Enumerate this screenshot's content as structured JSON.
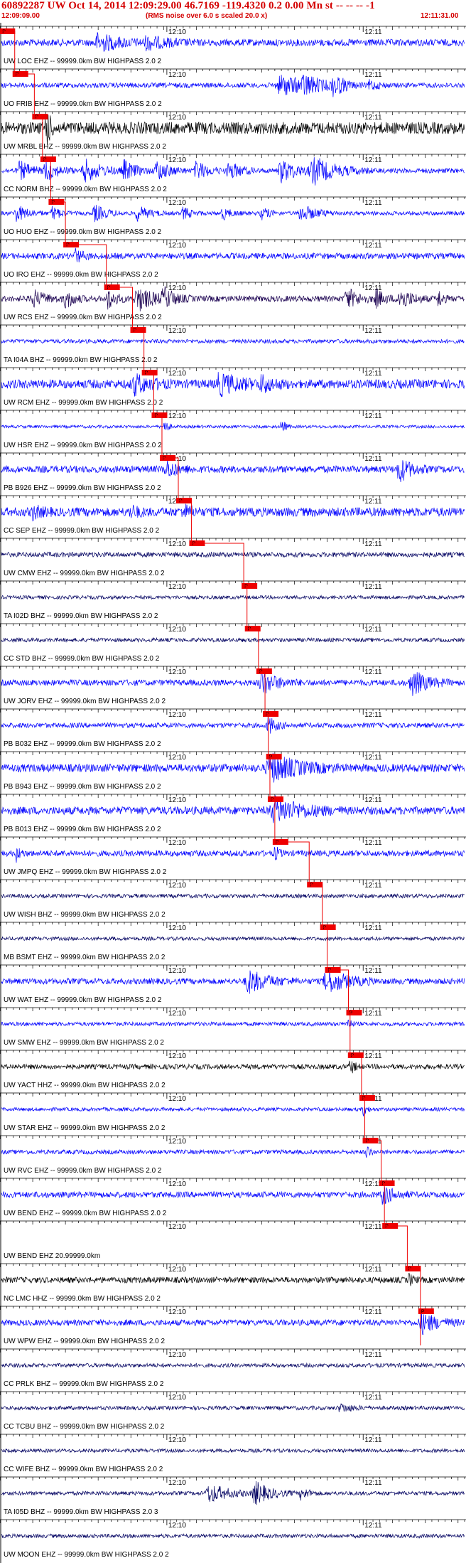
{
  "header": {
    "title": "60892287 UW Oct 14, 2014 12:09:29.00   46.7169 -119.4320  0.2 0.00 Mn st -- -- --  -1",
    "start_time": "12:09:09.00",
    "scale_note": "(RMS noise over 6.0 s scaled 20.0 x)",
    "end_time": "12:11:31.00"
  },
  "chart_data": {
    "type": "line",
    "title": "60892287 UW Oct 14, 2014 12:09:29.00   46.7169 -119.4320  0.2 0.00 Mn st -- -- --  -1",
    "x_axis": {
      "unit": "seconds after 12:09:09.00",
      "range": [
        0,
        142
      ],
      "tick_labels": [
        "12:10",
        "12:11"
      ],
      "tick_label_offsets_s": [
        51,
        111
      ]
    },
    "pick_label": "P",
    "traces": [
      {
        "label": "UW LOC EHZ -- 99999.0km BW  HIGHPASS  2.0  2",
        "color": "#0000ff",
        "pick_s": 0.5,
        "amplitude": 0.35,
        "bursts": [
          [
            30,
            5,
            0.9
          ],
          [
            45,
            5,
            0.6
          ]
        ]
      },
      {
        "label": "UO FRIB EHZ -- 99999.0km BW  HIGHPASS  2.0  2",
        "color": "#0000ff",
        "pick_s": 4.5,
        "amplitude": 0.25,
        "bursts": [
          [
            86,
            7,
            1.0
          ],
          [
            93,
            4,
            0.7
          ],
          [
            102,
            3,
            0.9
          ],
          [
            113,
            2,
            0.5
          ]
        ]
      },
      {
        "label": "UW MRBL BHZ -- 99999.0km BW  HIGHPASS  2.0  2",
        "color": "#000000",
        "pick_s": 10.5,
        "amplitude": 0.6,
        "bursts": [
          [
            14,
            1,
            2.2
          ]
        ]
      },
      {
        "label": "CC NORM BHZ -- 99999.0km BW  HIGHPASS  2.0  2",
        "color": "#0000ff",
        "pick_s": 13.0,
        "amplitude": 0.25,
        "bursts": [
          [
            6,
            3,
            0.9
          ],
          [
            14,
            3,
            1.0
          ],
          [
            26,
            4,
            1.1
          ],
          [
            38,
            3,
            1.0
          ],
          [
            48,
            3,
            1.0
          ],
          [
            60,
            3,
            0.9
          ],
          [
            70,
            3,
            0.9
          ],
          [
            86,
            4,
            1.1
          ],
          [
            96,
            6,
            1.2
          ]
        ]
      },
      {
        "label": "UO HUO EHZ -- 99999.0km BW  HIGHPASS  2.0  2",
        "color": "#0000ff",
        "pick_s": 15.5,
        "amplitude": 0.2,
        "bursts": [
          [
            5,
            3,
            0.8
          ],
          [
            16,
            2,
            0.7
          ],
          [
            29,
            3,
            0.8
          ],
          [
            42,
            3,
            0.7
          ],
          [
            56,
            2,
            0.6
          ],
          [
            68,
            2,
            0.6
          ],
          [
            80,
            2,
            0.6
          ],
          [
            92,
            4,
            0.8
          ]
        ]
      },
      {
        "label": "UO IRO EHZ -- 99999.0km BW  HIGHPASS  2.0  2",
        "color": "#0000ff",
        "pick_s": 20.0,
        "amplitude": 0.3,
        "bursts": [
          [
            23,
            2,
            0.6
          ]
        ]
      },
      {
        "label": "UW RCS EHZ -- 99999.0km BW  HIGHPASS  2.0  2",
        "color": "#1a0050",
        "pick_s": 32.5,
        "amplitude": 0.3,
        "bursts": [
          [
            10,
            3,
            0.8
          ],
          [
            20,
            2,
            1.0
          ],
          [
            33,
            2,
            1.0
          ],
          [
            42,
            4,
            1.2
          ],
          [
            50,
            3,
            0.9
          ],
          [
            106,
            3,
            1.0
          ],
          [
            115,
            2,
            0.9
          ],
          [
            122,
            3,
            1.1
          ],
          [
            134,
            1,
            1.0
          ]
        ]
      },
      {
        "label": "TA I04A BHZ -- 99999.0km BW  HIGHPASS  2.0  2",
        "color": "#0000ff",
        "pick_s": 40.5,
        "amplitude": 0.2,
        "bursts": []
      },
      {
        "label": "UW RCM EHZ -- 99999.0km BW  HIGHPASS  2.0  2",
        "color": "#0000ff",
        "pick_s": 44.0,
        "amplitude": 0.45,
        "bursts": [
          [
            41,
            4,
            0.9
          ],
          [
            67,
            5,
            1.0
          ],
          [
            80,
            3,
            0.7
          ]
        ]
      },
      {
        "label": "UW HSR EHZ -- 99999.0km BW  HIGHPASS  2.0  2",
        "color": "#0000ff",
        "pick_s": 47.0,
        "amplitude": 0.15,
        "bursts": [
          [
            50,
            1,
            0.8
          ],
          [
            86,
            1,
            0.8
          ]
        ]
      },
      {
        "label": "PB B926 EHZ -- 99999.0km BW  HIGHPASS  2.0  2",
        "color": "#0000ff",
        "pick_s": 49.5,
        "amplitude": 0.35,
        "bursts": [
          [
            51,
            3,
            0.8
          ],
          [
            122,
            3,
            1.2
          ]
        ]
      },
      {
        "label": "CC SEP EHZ -- 99999.0km BW  HIGHPASS  2.0  2",
        "color": "#0000ff",
        "pick_s": 54.5,
        "amplitude": 0.45,
        "bursts": [
          [
            10,
            2,
            0.6
          ],
          [
            40,
            2,
            0.5
          ],
          [
            56,
            2,
            0.6
          ]
        ]
      },
      {
        "label": "UW CMW EHZ -- 99999.0km BW  HIGHPASS  2.0  2",
        "color": "#000060",
        "pick_s": 58.5,
        "amplitude": 0.25,
        "bursts": []
      },
      {
        "label": "TA I02D BHZ -- 99999.0km BW  HIGHPASS  2.0  2",
        "color": "#000060",
        "pick_s": 74.5,
        "amplitude": 0.18,
        "bursts": []
      },
      {
        "label": "CC STD BHZ -- 99999.0km BW  HIGHPASS  2.0  2",
        "color": "#000060",
        "pick_s": 75.5,
        "amplitude": 0.2,
        "bursts": []
      },
      {
        "label": "UW JORV EHZ -- 99999.0km BW  HIGHPASS  2.0  2",
        "color": "#0000ff",
        "pick_s": 79.0,
        "amplitude": 0.3,
        "bursts": [
          [
            80,
            4,
            1.1
          ],
          [
            126,
            4,
            1.2
          ]
        ]
      },
      {
        "label": "PB B032 EHZ -- 99999.0km BW  HIGHPASS  2.0  2",
        "color": "#0000ff",
        "pick_s": 81.0,
        "amplitude": 0.25,
        "bursts": [
          [
            82,
            2,
            0.9
          ]
        ]
      },
      {
        "label": "PB B943 EHZ -- 99999.0km BW  HIGHPASS  2.0  2",
        "color": "#0000ff",
        "pick_s": 82.0,
        "amplitude": 0.4,
        "bursts": [
          [
            83,
            7,
            1.3
          ]
        ]
      },
      {
        "label": "PB B013 EHZ -- 99999.0km BW  HIGHPASS  2.0  2",
        "color": "#0000ff",
        "pick_s": 82.5,
        "amplitude": 0.4,
        "bursts": [
          [
            84,
            7,
            1.2
          ]
        ]
      },
      {
        "label": "UW JMPQ EHZ -- 99999.0km BW  HIGHPASS  2.0  2",
        "color": "#0000ff",
        "pick_s": 84.0,
        "amplitude": 0.3,
        "bursts": [
          [
            5,
            1,
            0.7
          ],
          [
            84,
            1,
            0.7
          ]
        ]
      },
      {
        "label": "UW WISH BHZ -- 99999.0km BW  HIGHPASS  2.0  2",
        "color": "#000060",
        "pick_s": 94.5,
        "amplitude": 0.2,
        "bursts": []
      },
      {
        "label": "MB BSMT EHZ -- 99999.0km BW  HIGHPASS  2.0  2",
        "color": "#000060",
        "pick_s": 98.5,
        "amplitude": 0.18,
        "bursts": []
      },
      {
        "label": "UW WAT EHZ -- 99999.0km BW  HIGHPASS  2.0  2",
        "color": "#0000ff",
        "pick_s": 100.0,
        "amplitude": 0.3,
        "bursts": [
          [
            76,
            5,
            1.1
          ],
          [
            100,
            5,
            1.2
          ]
        ]
      },
      {
        "label": "UW SMW EHZ -- 99999.0km BW  HIGHPASS  2.0  2",
        "color": "#0000ff",
        "pick_s": 106.5,
        "amplitude": 0.2,
        "bursts": [
          [
            106,
            1,
            0.6
          ]
        ]
      },
      {
        "label": "UW YACT HHZ -- 99999.0km BW  HIGHPASS  2.0  2",
        "color": "#000000",
        "pick_s": 107.0,
        "amplitude": 0.25,
        "bursts": [
          [
            107,
            1,
            0.9
          ]
        ]
      },
      {
        "label": "UW STAR EHZ -- 99999.0km BW  HIGHPASS  2.0  2",
        "color": "#0000ff",
        "pick_s": 110.5,
        "amplitude": 0.18,
        "bursts": [
          [
            111,
            1,
            0.6
          ]
        ]
      },
      {
        "label": "UW RVC EHZ -- 99999.0km BW  HIGHPASS  2.0  2",
        "color": "#0000ff",
        "pick_s": 111.5,
        "amplitude": 0.22,
        "bursts": [
          [
            112,
            1,
            0.6
          ]
        ]
      },
      {
        "label": "UW BEND EHZ -- 99999.0km BW  HIGHPASS  2.0  2",
        "color": "#0000ff",
        "pick_s": 116.5,
        "amplitude": 0.3,
        "bursts": [
          [
            117,
            3,
            0.9
          ]
        ]
      },
      {
        "label": "UW BEND EHZ 20.99999.0km",
        "color": "#0000ff",
        "pick_s": 117.5,
        "amplitude": 0.0,
        "bursts": []
      },
      {
        "label": "NC LMC HHZ -- 99999.0km BW  HIGHPASS  2.0  2",
        "color": "#000000",
        "pick_s": 124.5,
        "amplitude": 0.3,
        "bursts": [
          [
            125,
            1,
            0.6
          ]
        ]
      },
      {
        "label": "UW WPW EHZ -- 99999.0km BW  HIGHPASS  2.0  2",
        "color": "#0000ff",
        "pick_s": 128.5,
        "amplitude": 0.3,
        "bursts": [
          [
            129,
            4,
            1.0
          ]
        ]
      },
      {
        "label": "CC PRLK BHZ -- 99999.0km BW  HIGHPASS  2.0  2",
        "color": "#000060",
        "pick_s": null,
        "amplitude": 0.2,
        "bursts": []
      },
      {
        "label": "CC TCBU BHZ -- 99999.0km BW  HIGHPASS  2.0  2",
        "color": "#000060",
        "pick_s": null,
        "amplitude": 0.2,
        "bursts": [
          [
            104,
            3,
            0.4
          ]
        ]
      },
      {
        "label": "CC WIFE BHZ -- 99999.0km BW  HIGHPASS  2.0  2",
        "color": "#000060",
        "pick_s": null,
        "amplitude": 0.18,
        "bursts": []
      },
      {
        "label": "TA I05D BHZ -- 99999.0km BW  HIGHPASS  2.0  3",
        "color": "#000060",
        "pick_s": null,
        "amplitude": 0.2,
        "bursts": [
          [
            64,
            5,
            0.9
          ],
          [
            78,
            4,
            1.1
          ],
          [
            92,
            2,
            0.6
          ]
        ]
      },
      {
        "label": "UW MOON EHZ -- 99999.0km BW  HIGHPASS  2.0  2",
        "color": "#000060",
        "pick_s": null,
        "amplitude": 0.2,
        "bursts": []
      }
    ]
  }
}
